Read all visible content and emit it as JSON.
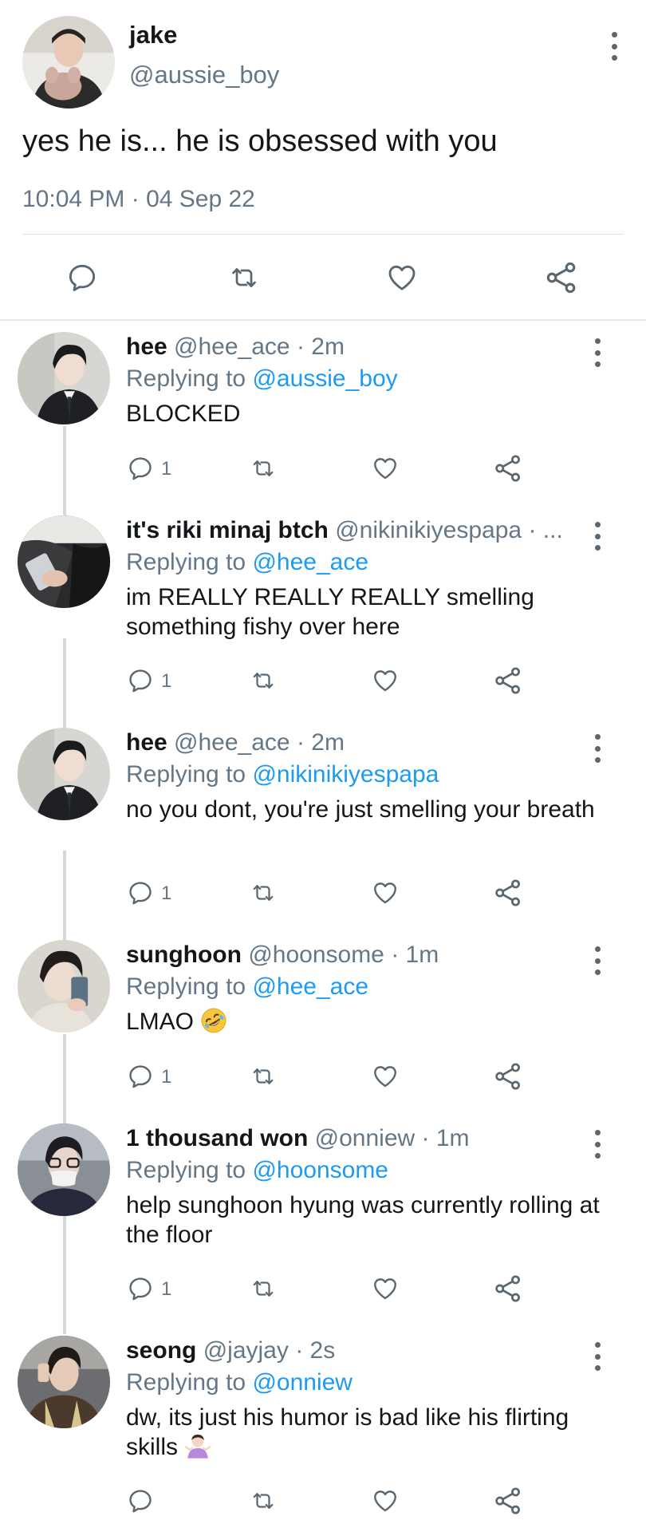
{
  "main_tweet": {
    "name": "jake",
    "handle": "@aussie_boy",
    "text": "yes he is... he is obsessed with you",
    "time": "10:04 PM · 04 Sep 22"
  },
  "replies": [
    {
      "name": "hee",
      "handle": "@hee_ace · 2m",
      "replying_prefix": "Replying to ",
      "replying_to": "@aussie_boy",
      "text": "BLOCKED",
      "reply_count": "1"
    },
    {
      "name": "it's riki minaj btch",
      "handle": "@nikinikiyespapa · ...",
      "replying_prefix": "Replying to ",
      "replying_to": "@hee_ace",
      "text": "im REALLY REALLY REALLY smelling something fishy over here",
      "reply_count": "1"
    },
    {
      "name": "hee",
      "handle": "@hee_ace · 2m",
      "replying_prefix": "Replying to ",
      "replying_to": "@nikinikiyespapa",
      "text": "no you dont, you're just smelling your breath",
      "reply_count": "1"
    },
    {
      "name": "sunghoon",
      "handle": "@hoonsome · 1m",
      "replying_prefix": "Replying to ",
      "replying_to": "@hee_ace",
      "text": "LMAO",
      "emoji": "rolling-on-floor-laughing-emoji",
      "reply_count": "1"
    },
    {
      "name": "1 thousand won",
      "handle": "@onniew · 1m",
      "replying_prefix": "Replying to ",
      "replying_to": "@hoonsome",
      "text": "help sunghoon hyung was currently rolling at the floor",
      "reply_count": "1"
    },
    {
      "name": "seong",
      "handle": "@jayjay · 2s",
      "replying_prefix": "Replying to ",
      "replying_to": "@onniew",
      "text": "dw, its just his humor is bad like his flirting skills",
      "emoji": "person-shrugging-emoji",
      "reply_count": ""
    }
  ],
  "icons": [
    "reply-icon",
    "retweet-icon",
    "like-icon",
    "share-icon",
    "more-options-icon"
  ],
  "colors": {
    "accent": "#1d9bf0",
    "secondary_text": "#657786",
    "icon": "#5b6770",
    "divider": "#e6e9ec"
  }
}
